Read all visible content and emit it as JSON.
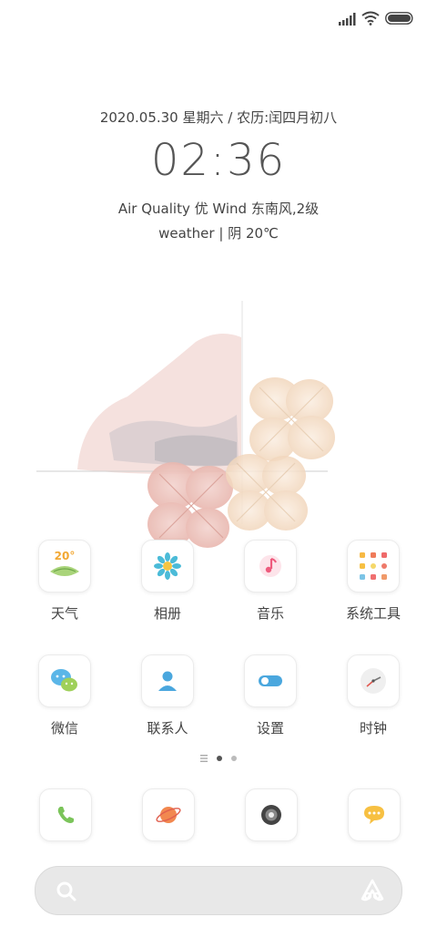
{
  "status": {
    "signal_icon": "signal-bars-icon",
    "wifi_icon": "wifi-icon",
    "battery_icon": "battery-icon"
  },
  "widget": {
    "date": "2020.05.30 星期六  /  农历:闰四月初八",
    "time": "02:36",
    "air": "Air Quality 优 Wind 东南风,2级",
    "weather": "weather | 阴 20℃"
  },
  "apps_row1": [
    {
      "label": "天气",
      "icon": "weather-icon",
      "badge": "20°"
    },
    {
      "label": "相册",
      "icon": "gallery-flower-icon"
    },
    {
      "label": "音乐",
      "icon": "music-note-icon"
    },
    {
      "label": "系统工具",
      "icon": "system-tools-folder-icon"
    }
  ],
  "apps_row2": [
    {
      "label": "微信",
      "icon": "wechat-icon"
    },
    {
      "label": "联系人",
      "icon": "contacts-icon"
    },
    {
      "label": "设置",
      "icon": "settings-toggle-icon"
    },
    {
      "label": "时钟",
      "icon": "clock-icon"
    }
  ],
  "dock": [
    {
      "icon": "phone-icon"
    },
    {
      "icon": "browser-planet-icon"
    },
    {
      "icon": "camera-icon"
    },
    {
      "icon": "messages-icon"
    }
  ],
  "pager": {
    "pages": 3,
    "current": 1
  },
  "colors": {
    "accent_green": "#7bc45a",
    "accent_blue": "#4aa7de",
    "accent_pink": "#f06a8a",
    "accent_orange": "#f2884f",
    "accent_yellow": "#f7c042"
  }
}
